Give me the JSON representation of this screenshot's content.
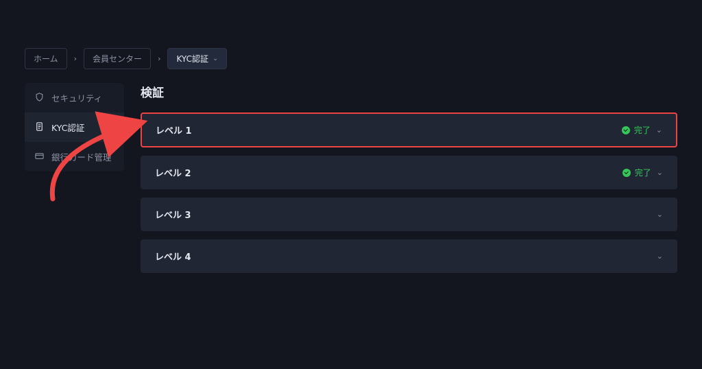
{
  "breadcrumbs": {
    "home": "ホーム",
    "member_center": "会員センター",
    "current": "KYC認証"
  },
  "sidebar": {
    "items": [
      {
        "label": "セキュリティ"
      },
      {
        "label": "KYC認証"
      },
      {
        "label": "銀行カード管理"
      }
    ]
  },
  "main": {
    "title": "検証",
    "status_completed": "完了",
    "levels": [
      {
        "label": "レベル 1",
        "completed": true,
        "highlight": true
      },
      {
        "label": "レベル 2",
        "completed": true,
        "highlight": false
      },
      {
        "label": "レベル 3",
        "completed": false,
        "highlight": false
      },
      {
        "label": "レベル 4",
        "completed": false,
        "highlight": false
      }
    ]
  }
}
